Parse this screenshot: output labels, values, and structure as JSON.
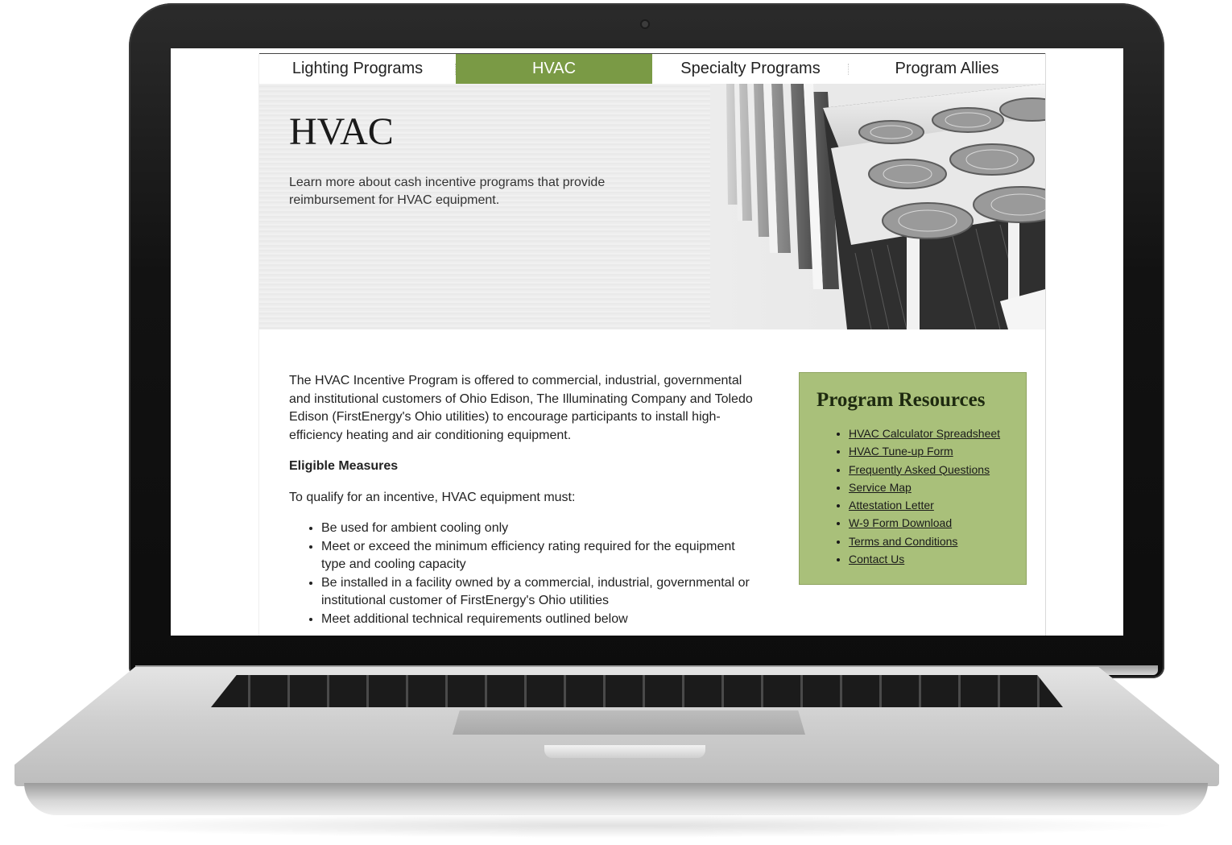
{
  "nav": {
    "items": [
      {
        "label": "Lighting Programs",
        "active": false
      },
      {
        "label": "HVAC",
        "active": true
      },
      {
        "label": "Specialty Programs",
        "active": false
      },
      {
        "label": "Program Allies",
        "active": false
      }
    ],
    "active_color": "#7a9a45"
  },
  "hero": {
    "title": "HVAC",
    "description": "Learn more about cash incentive programs that provide reimbursement for HVAC equipment.",
    "image_icon": "rooftop-hvac-units-image"
  },
  "main": {
    "intro": "The HVAC Incentive Program is offered to commercial, industrial, governmental and institutional customers of Ohio Edison, The Illuminating Company and Toledo Edison (FirstEnergy's Ohio utilities) to encourage participants to install high-efficiency heating and air conditioning equipment.",
    "eligible_heading": "Eligible Measures",
    "qualify_text": "To qualify for an incentive, HVAC equipment must:",
    "requirements": [
      "Be used for ambient cooling only",
      "Meet or exceed the minimum efficiency rating required for the equipment type and cooling capacity",
      "Be installed in a facility owned by a commercial, industrial, governmental or institutional customer of FirstEnergy's Ohio utilities",
      "Meet additional technical requirements outlined below"
    ]
  },
  "resources": {
    "title": "Program Resources",
    "background_color": "#a9c07a",
    "links": [
      "HVAC Calculator Spreadsheet",
      "HVAC Tune-up Form",
      "Frequently Asked Questions",
      "Service Map",
      "Attestation Letter",
      "W-9 Form Download",
      "Terms and Conditions",
      "Contact Us"
    ]
  }
}
